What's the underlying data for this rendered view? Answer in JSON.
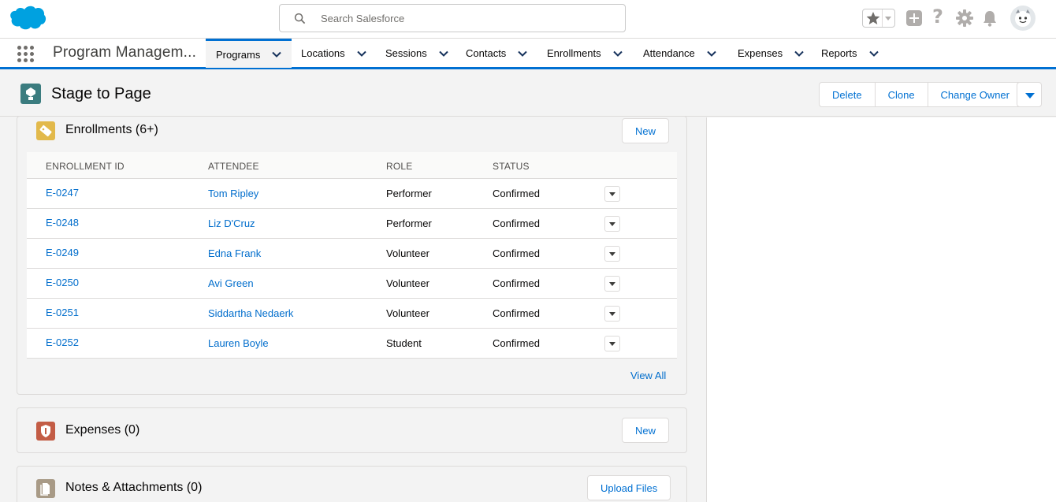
{
  "search": {
    "placeholder": "Search Salesforce"
  },
  "nav": {
    "app_name": "Program Managem...",
    "tabs": [
      {
        "label": "Programs"
      },
      {
        "label": "Locations"
      },
      {
        "label": "Sessions"
      },
      {
        "label": "Contacts"
      },
      {
        "label": "Enrollments"
      },
      {
        "label": "Attendance"
      },
      {
        "label": "Expenses"
      },
      {
        "label": "Reports"
      }
    ]
  },
  "record": {
    "title": "Stage to Page",
    "actions": {
      "delete": "Delete",
      "clone": "Clone",
      "change_owner": "Change Owner"
    }
  },
  "enrollments": {
    "title": "Enrollments (6+)",
    "new_label": "New",
    "columns": [
      "ENROLLMENT ID",
      "ATTENDEE",
      "ROLE",
      "STATUS"
    ],
    "rows": [
      {
        "id": "E-0247",
        "attendee": "Tom Ripley",
        "role": "Performer",
        "status": "Confirmed"
      },
      {
        "id": "E-0248",
        "attendee": "Liz D'Cruz",
        "role": "Performer",
        "status": "Confirmed"
      },
      {
        "id": "E-0249",
        "attendee": "Edna Frank",
        "role": "Volunteer",
        "status": "Confirmed"
      },
      {
        "id": "E-0250",
        "attendee": "Avi Green",
        "role": "Volunteer",
        "status": "Confirmed"
      },
      {
        "id": "E-0251",
        "attendee": "Siddartha Nedaerk",
        "role": "Volunteer",
        "status": "Confirmed"
      },
      {
        "id": "E-0252",
        "attendee": "Lauren Boyle",
        "role": "Student",
        "status": "Confirmed"
      }
    ],
    "view_all": "View All"
  },
  "expenses": {
    "title": "Expenses (0)",
    "new_label": "New"
  },
  "notes": {
    "title": "Notes & Attachments (0)",
    "upload_label": "Upload Files"
  },
  "colors": {
    "brand": "#00a1e0",
    "accent": "#0070d2",
    "link": "#006dcc"
  }
}
